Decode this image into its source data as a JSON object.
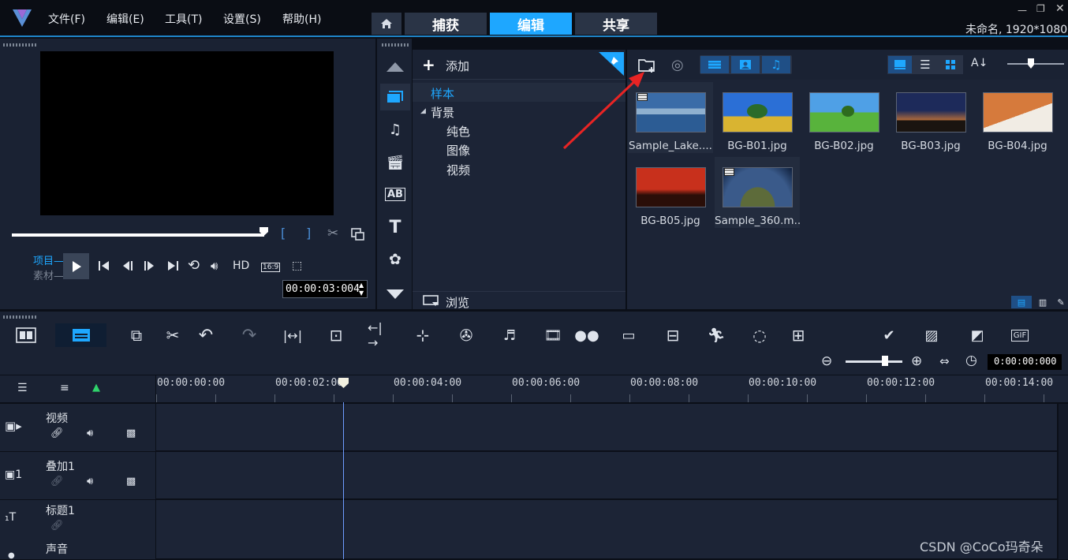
{
  "menu": {
    "file": "文件(F)",
    "edit": "编辑(E)",
    "tools": "工具(T)",
    "settings": "设置(S)",
    "help": "帮助(H)"
  },
  "workspace_tabs": {
    "capture": "捕获",
    "edit": "编辑",
    "share": "共享"
  },
  "project_info": "未命名, 1920*1080",
  "player": {
    "project_label": "项目",
    "clip_label": "素材",
    "hd": "HD",
    "aspect": "16:9",
    "timecode": "00:00:03:004"
  },
  "library": {
    "add_label": "添加",
    "browse_label": "浏览",
    "tree": {
      "sample": "样本",
      "background": "背景",
      "solid": "纯色",
      "image": "图像",
      "video": "视频"
    },
    "thumbnails": [
      {
        "name": "Sample_Lake...."
      },
      {
        "name": "BG-B01.jpg"
      },
      {
        "name": "BG-B02.jpg"
      },
      {
        "name": "BG-B03.jpg"
      },
      {
        "name": "BG-B04.jpg"
      },
      {
        "name": "BG-B05.jpg"
      },
      {
        "name": "Sample_360.m..."
      }
    ]
  },
  "timeline": {
    "zoom_timecode": "0:00:00:000",
    "ruler": [
      "00:00:00:00",
      "00:00:02:00",
      "00:00:04:00",
      "00:00:06:00",
      "00:00:08:00",
      "00:00:10:00",
      "00:00:12:00",
      "00:00:14:00"
    ],
    "tracks": {
      "video": "视频",
      "overlay": "叠加1",
      "title": "标题1",
      "sound": "声音"
    },
    "gif": "GIF"
  },
  "watermark": "CSDN @CoCo玛奇朵",
  "colors": {
    "accent": "#1ea7ff",
    "panel": "#1a2233",
    "bg": "#0b0f18"
  }
}
